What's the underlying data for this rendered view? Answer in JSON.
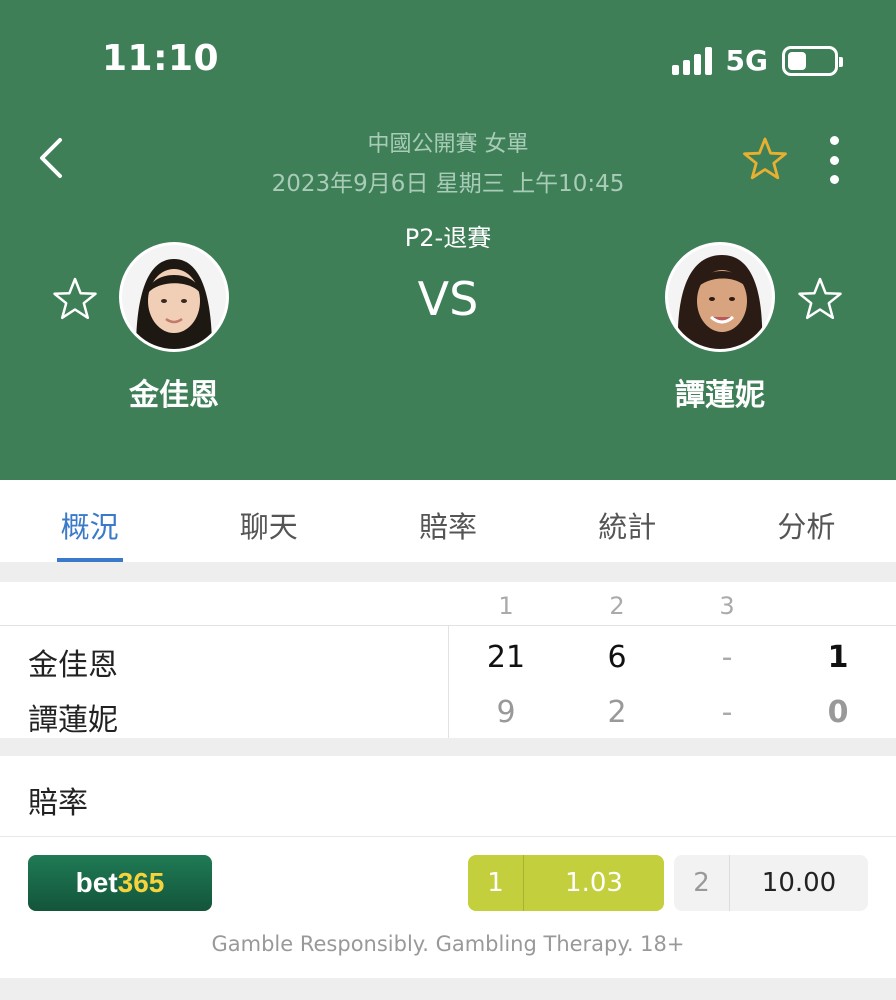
{
  "status_bar": {
    "time": "11:10",
    "network": "5G"
  },
  "header": {
    "league": "中國公開賽 女單",
    "datetime": "2023年9月6日 星期三 上午10:45",
    "match_status": "P2-退賽",
    "vs": "VS",
    "player_left": "金佳恩",
    "player_right": "譚蓮妮"
  },
  "tabs": [
    "概況",
    "聊天",
    "賠率",
    "統計",
    "分析"
  ],
  "active_tab": 0,
  "scoreboard": {
    "set_headers": [
      "1",
      "2",
      "3"
    ],
    "rows": [
      {
        "name": "金佳恩",
        "sets": [
          "21",
          "6",
          "-"
        ],
        "total": "1"
      },
      {
        "name": "譚蓮妮",
        "sets": [
          "9",
          "2",
          "-"
        ],
        "total": "0"
      }
    ]
  },
  "odds": {
    "title": "賠率",
    "bookmaker_left": "bet",
    "bookmaker_right": "365",
    "home_label": "1",
    "home_value": "1.03",
    "away_label": "2",
    "away_value": "10.00",
    "disclaimer": "Gamble Responsibly. Gambling Therapy. 18+"
  },
  "colors": {
    "header_bg": "#3e7f58",
    "accent_blue": "#3a7ac9",
    "odds_green": "#c3cf3c",
    "star_gold": "#e8b030"
  }
}
